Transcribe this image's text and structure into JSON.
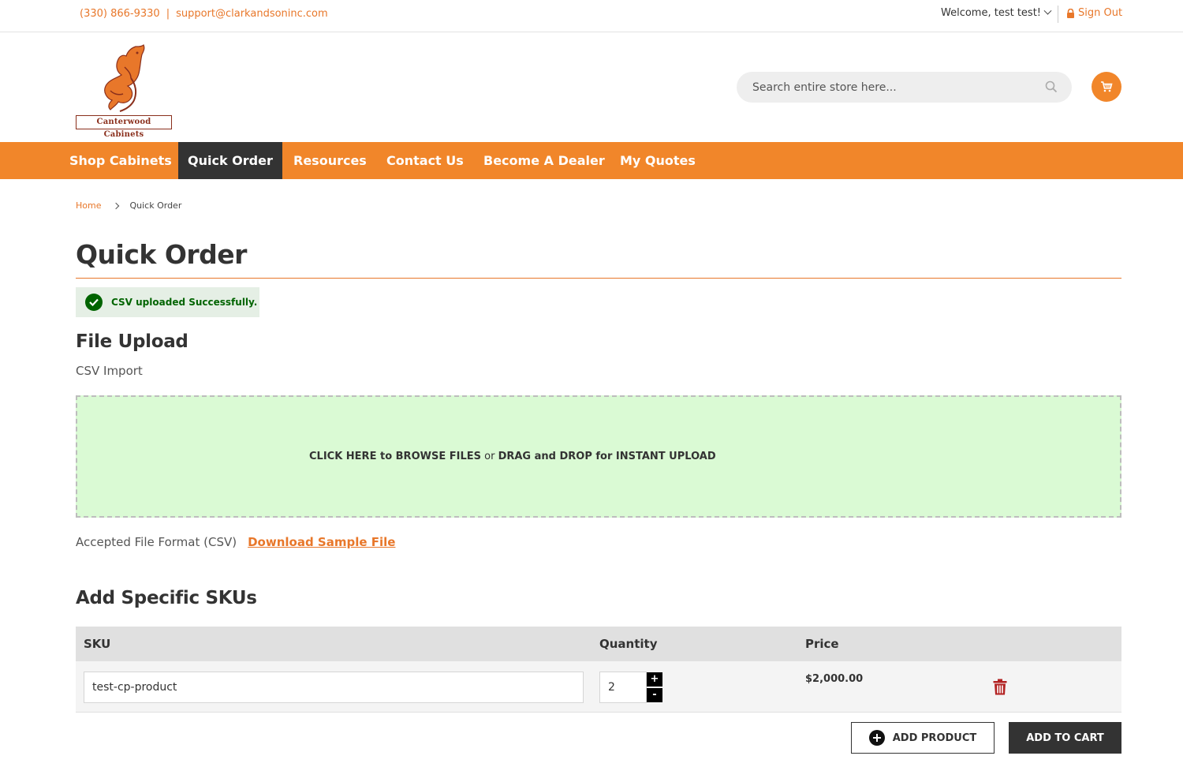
{
  "topbar": {
    "phone": "(330) 866-9330",
    "separator": "|",
    "email": "support@clarkandsoninc.com",
    "welcome": "Welcome, test test!",
    "signout": "Sign Out"
  },
  "header": {
    "logo_text": "Canterwood Cabinets",
    "search_placeholder": "Search entire store here...",
    "cart_icon": "cart-icon"
  },
  "nav": {
    "items": [
      {
        "label": "Shop Cabinets",
        "active": false
      },
      {
        "label": "Quick Order",
        "active": true
      },
      {
        "label": "Resources",
        "active": false
      },
      {
        "label": "Contact Us",
        "active": false
      },
      {
        "label": "Become A Dealer",
        "active": false
      },
      {
        "label": "My Quotes",
        "active": false
      }
    ]
  },
  "breadcrumb": {
    "home": "Home",
    "current": "Quick Order"
  },
  "page": {
    "title": "Quick Order",
    "success_message": "CSV uploaded Successfully."
  },
  "file_upload": {
    "heading": "File Upload",
    "subheading": "CSV Import",
    "dz_part1": "CLICK HERE to BROWSE FILES",
    "dz_part2": " or ",
    "dz_part3": "DRAG and DROP for INSTANT UPLOAD",
    "accepted": "Accepted File Format (CSV)",
    "download_link": "Download Sample File"
  },
  "skus": {
    "heading": "Add Specific SKUs",
    "columns": {
      "sku": "SKU",
      "quantity": "Quantity",
      "price": "Price"
    },
    "rows": [
      {
        "sku": "test-cp-product",
        "quantity": "2",
        "price": "$2,000.00"
      }
    ],
    "plus": "+",
    "minus": "-",
    "add_product": "ADD PRODUCT",
    "add_to_cart": "ADD TO CART"
  },
  "colors": {
    "accent": "#f1862a",
    "dark": "#333333",
    "success": "#006400",
    "dropzone_bg": "#dafad4",
    "trash": "#b22222"
  }
}
